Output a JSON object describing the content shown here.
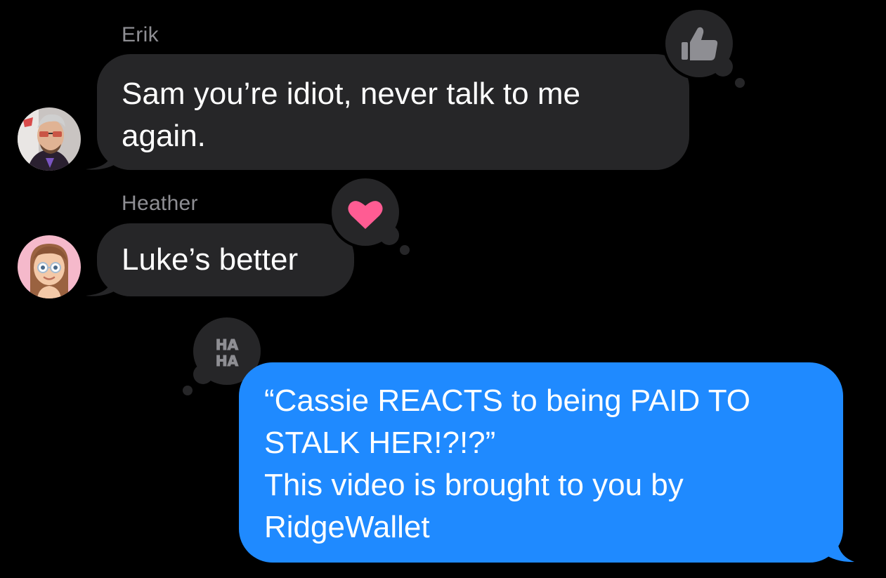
{
  "colors": {
    "background": "#000000",
    "incoming_bubble": "#262628",
    "outgoing_bubble": "#1f8aff",
    "sender_name": "#8e8e93",
    "reaction_bubble": "#262628",
    "heart": "#ff5c93",
    "thumbs_up": "#8e8e93"
  },
  "messages": [
    {
      "sender": "Erik",
      "avatar": "erik-avatar-photo",
      "text": "Sam you’re idiot, never talk to me\nagain.",
      "reaction": "thumbs-up-icon"
    },
    {
      "sender": "Heather",
      "avatar": "heather-memoji-avatar",
      "text": "Luke’s better",
      "reaction": "heart-icon"
    },
    {
      "outgoing": true,
      "text": "“Cassie REACTS to being PAID TO\nSTALK HER!?!?”\nThis video is brought to you by\nRidgeWallet",
      "reaction": "haha-icon",
      "reaction_text": "HA\nHA"
    }
  ]
}
